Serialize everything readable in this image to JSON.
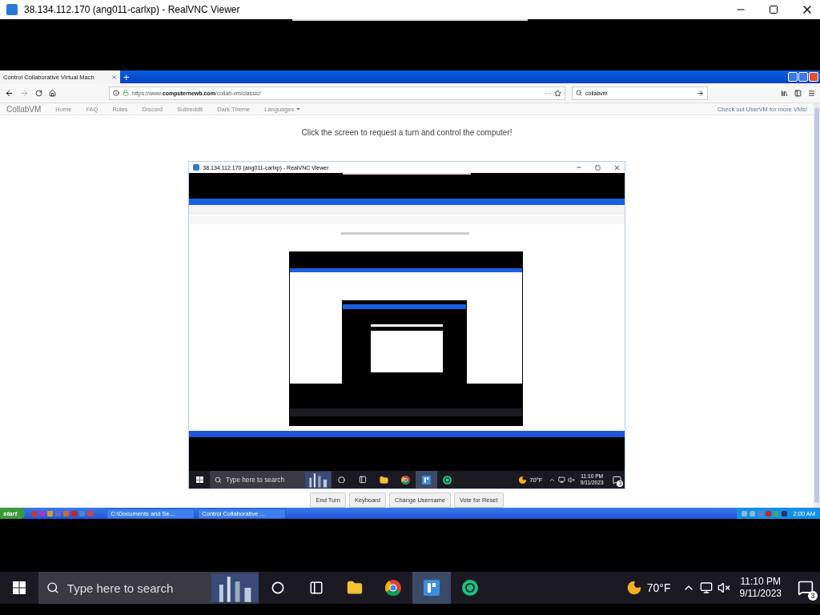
{
  "vnc_window": {
    "title": "38.134.112.170 (ang011-carlxp) - RealVNC Viewer"
  },
  "browser": {
    "tabs": [
      {
        "label": "Control Collaborative Virtual Mach",
        "selected": true
      }
    ],
    "new_tab": "+",
    "url": "https://www.**computernewb.com**/collab-vm/classic/",
    "page_actions": "···",
    "search": {
      "value": "collabvm"
    }
  },
  "site_nav": {
    "brand": "CollabVM",
    "links": [
      "Home",
      "FAQ",
      "Rules",
      "Discord",
      "Subreddit",
      "Dark Theme",
      "Languages"
    ],
    "promo": "Check out UserVM for more VMs!"
  },
  "prompt": "Click the screen to request a turn and control the computer!",
  "vm_screen": {
    "title": "38.134.112.170 (ang011-carlxp) - RealVNC Viewer",
    "taskbar": {
      "search_placeholder": "Type here to search",
      "weather": "70°F",
      "time": "11:10 PM",
      "date": "9/11/2023",
      "notifications": "3"
    }
  },
  "vm_buttons": [
    "End Turn",
    "Keyboard",
    "Change Username",
    "Vote for Reset"
  ],
  "xp_taskbar": {
    "start": "start",
    "tasks": [
      "C:\\Documents and Se...",
      "Control Collaborative ..."
    ],
    "clock": "2:00 AM"
  },
  "win_taskbar": {
    "search_placeholder": "Type here to search",
    "weather": "70°F",
    "time": "11:10 PM",
    "date": "9/11/2023",
    "notifications": "3"
  }
}
